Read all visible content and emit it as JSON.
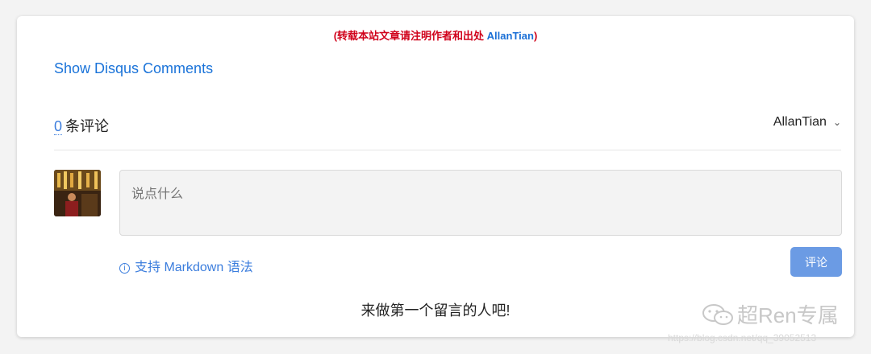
{
  "notice": {
    "text": "(转载本站文章请注明作者和出处 ",
    "author": "AllanTian",
    "suffix": ")"
  },
  "show_disqus": "Show Disqus Comments",
  "comments": {
    "count": "0",
    "count_label": "条评论"
  },
  "user_menu": {
    "name": "AllanTian",
    "chevron": "⌄"
  },
  "comment_box": {
    "placeholder": "说点什么"
  },
  "markdown_hint": {
    "icon": "ⓘ",
    "text": "支持 Markdown 语法"
  },
  "submit_label": "评论",
  "empty_message": "来做第一个留言的人吧!",
  "watermark": {
    "text": "超Ren专属",
    "url": "https://blog.csdn.net/qq_39052513"
  },
  "colors": {
    "notice_red": "#d0021b",
    "link_blue": "#1a73d9",
    "button_blue": "#6b9be4"
  }
}
